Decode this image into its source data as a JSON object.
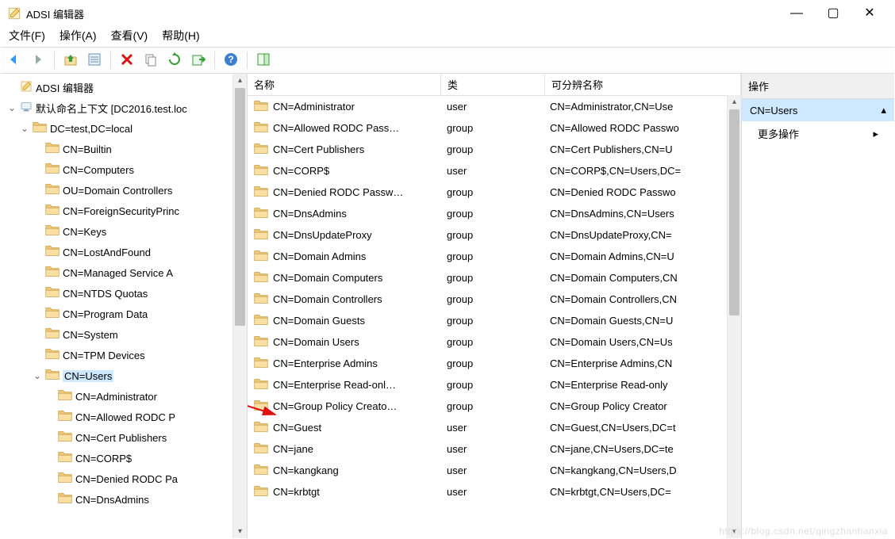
{
  "window": {
    "title": "ADSI 编辑器"
  },
  "menubar": [
    "文件(F)",
    "操作(A)",
    "查看(V)",
    "帮助(H)"
  ],
  "toolbar_icons": [
    "back-arrow",
    "forward-arrow",
    "sep",
    "up-folder",
    "properties",
    "sep",
    "delete",
    "copy",
    "refresh",
    "export",
    "sep",
    "help",
    "sep",
    "show-hide"
  ],
  "tree": {
    "root": "ADSI 编辑器",
    "context": "默认命名上下文 [DC2016.test.loc",
    "domain": "DC=test,DC=local",
    "children": [
      "CN=Builtin",
      "CN=Computers",
      "OU=Domain Controllers",
      "CN=ForeignSecurityPrinc",
      "CN=Keys",
      "CN=LostAndFound",
      "CN=Managed Service A",
      "CN=NTDS Quotas",
      "CN=Program Data",
      "CN=System",
      "CN=TPM Devices"
    ],
    "selected": "CN=Users",
    "selected_children": [
      "CN=Administrator",
      "CN=Allowed RODC P",
      "CN=Cert Publishers",
      "CN=CORP$",
      "CN=Denied RODC Pa",
      "CN=DnsAdmins"
    ]
  },
  "list": {
    "headers": {
      "name": "名称",
      "type": "类",
      "dn": "可分辨名称"
    },
    "rows": [
      {
        "name": "CN=Administrator",
        "type": "user",
        "dn": "CN=Administrator,CN=Use"
      },
      {
        "name": "CN=Allowed RODC Pass…",
        "type": "group",
        "dn": "CN=Allowed RODC Passwo"
      },
      {
        "name": "CN=Cert Publishers",
        "type": "group",
        "dn": "CN=Cert Publishers,CN=U"
      },
      {
        "name": "CN=CORP$",
        "type": "user",
        "dn": "CN=CORP$,CN=Users,DC="
      },
      {
        "name": "CN=Denied RODC Passw…",
        "type": "group",
        "dn": "CN=Denied RODC Passwo"
      },
      {
        "name": "CN=DnsAdmins",
        "type": "group",
        "dn": "CN=DnsAdmins,CN=Users"
      },
      {
        "name": "CN=DnsUpdateProxy",
        "type": "group",
        "dn": "CN=DnsUpdateProxy,CN="
      },
      {
        "name": "CN=Domain Admins",
        "type": "group",
        "dn": "CN=Domain Admins,CN=U"
      },
      {
        "name": "CN=Domain Computers",
        "type": "group",
        "dn": "CN=Domain Computers,CN"
      },
      {
        "name": "CN=Domain Controllers",
        "type": "group",
        "dn": "CN=Domain Controllers,CN"
      },
      {
        "name": "CN=Domain Guests",
        "type": "group",
        "dn": "CN=Domain Guests,CN=U"
      },
      {
        "name": "CN=Domain Users",
        "type": "group",
        "dn": "CN=Domain Users,CN=Us"
      },
      {
        "name": "CN=Enterprise Admins",
        "type": "group",
        "dn": "CN=Enterprise Admins,CN"
      },
      {
        "name": "CN=Enterprise Read-onl…",
        "type": "group",
        "dn": "CN=Enterprise Read-only "
      },
      {
        "name": "CN=Group Policy Creato…",
        "type": "group",
        "dn": "CN=Group Policy Creator "
      },
      {
        "name": "CN=Guest",
        "type": "user",
        "dn": "CN=Guest,CN=Users,DC=t"
      },
      {
        "name": "CN=jane",
        "type": "user",
        "dn": "CN=jane,CN=Users,DC=te"
      },
      {
        "name": "CN=kangkang",
        "type": "user",
        "dn": "CN=kangkang,CN=Users,D"
      },
      {
        "name": "CN=krbtgt",
        "type": "user",
        "dn": "CN=krbtgt,CN=Users,DC="
      }
    ]
  },
  "actions": {
    "title": "操作",
    "selection": "CN=Users",
    "more": "更多操作"
  },
  "watermark": "https://blog.csdn.net/qingzhantianxia"
}
